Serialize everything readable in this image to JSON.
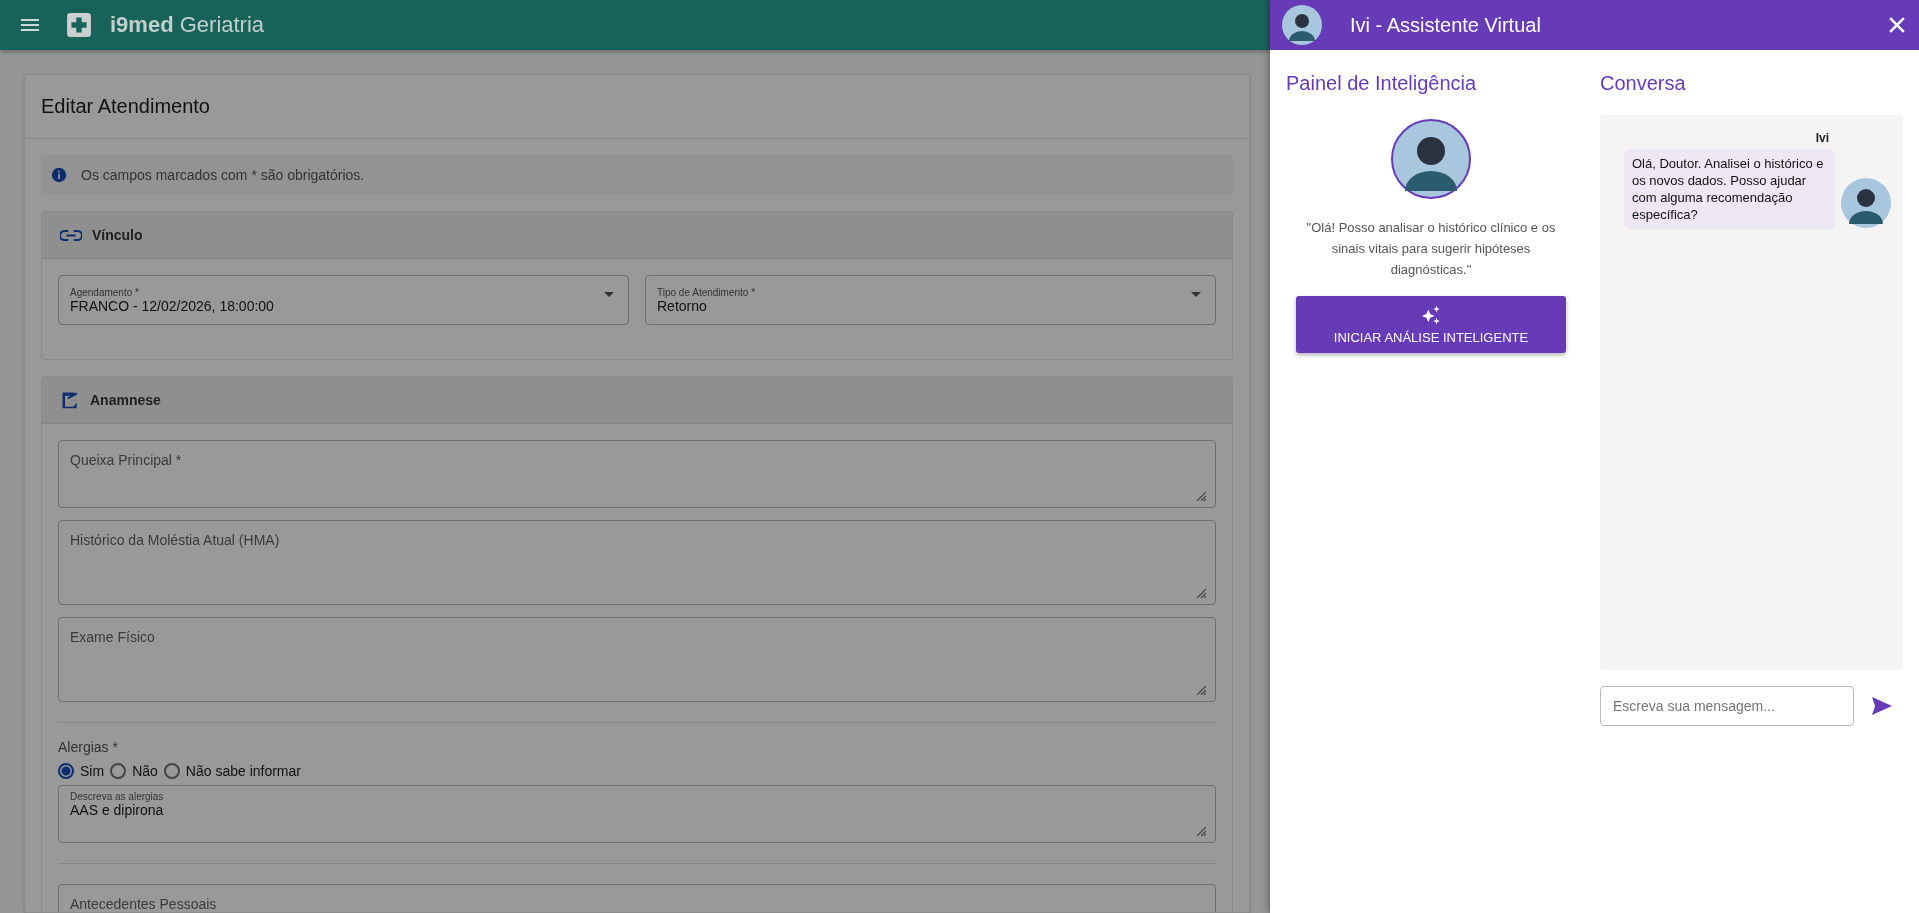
{
  "app_bar": {
    "brand": "i9med",
    "title": "Geriatria"
  },
  "form": {
    "title": "Editar Atendimento",
    "notice": "Os campos marcados com * são obrigatórios.",
    "vinculo": {
      "title": "Vínculo",
      "selects": [
        {
          "label": "Agendamento *",
          "value": "FRANCO - 12/02/2026, 18:00:00"
        },
        {
          "label": "Tipo de Atendimento *",
          "value": "Retorno"
        }
      ]
    },
    "anamnese": {
      "title": "Anamnese",
      "fields_top": [
        {
          "label": "Queixa Principal *"
        },
        {
          "label": "Histórico da Moléstia Atual (HMA)"
        },
        {
          "label": "Exame Físico"
        }
      ],
      "allergies": {
        "label": "Alergias *",
        "options": [
          {
            "label": "Sim",
            "selected": true
          },
          {
            "label": "Não",
            "selected": false
          },
          {
            "label": "Não sabe informar",
            "selected": false
          }
        ],
        "field": {
          "label": "Descreva as alergias",
          "value": "AAS e dipirona"
        }
      },
      "fields_bottom": [
        {
          "label": "Antecedentes Pessoais"
        }
      ]
    }
  },
  "drawer": {
    "title": "Ivi - Assistente Virtual",
    "panel": {
      "heading": "Painel de Inteligência",
      "quote": "\"Olá! Posso analisar o histórico clínico e os sinais vitais para sugerir hipóteses diagnósticas.\"",
      "button": "INICIAR ANÁLISE INTELIGENTE"
    },
    "chat": {
      "heading": "Conversa",
      "messages": [
        {
          "sender": "Ivi",
          "text": "Olá, Doutor. Analisei o histórico e os novos dados. Posso ajudar com alguma recomendação específica?"
        }
      ],
      "placeholder": "Escreva sua mensagem..."
    }
  }
}
